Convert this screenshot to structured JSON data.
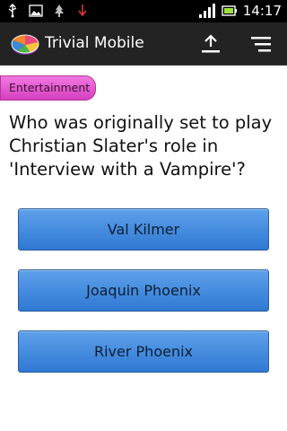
{
  "status_bar": {
    "time": "14:17",
    "left_icons": [
      "usb-icon",
      "image-icon",
      "tree-icon",
      "download-icon"
    ],
    "right_icons": [
      "signal-icon",
      "battery-icon"
    ]
  },
  "action_bar": {
    "title": "Trivial Mobile",
    "logo_icon": "pie-chart-logo-icon",
    "actions": [
      "upload-icon",
      "menu-icon"
    ],
    "background": "#232323"
  },
  "category": {
    "label": "Entertainment",
    "color": "#e35bd0"
  },
  "question": {
    "text": "Who was originally set to play Christian Slater's role in 'Interview with a Vampire'?"
  },
  "answers": [
    {
      "label": "Val Kilmer"
    },
    {
      "label": "Joaquin Phoenix"
    },
    {
      "label": "River Phoenix"
    }
  ],
  "colors": {
    "answer_button": "#4a8fe2",
    "answer_border": "#2a5e9f"
  }
}
